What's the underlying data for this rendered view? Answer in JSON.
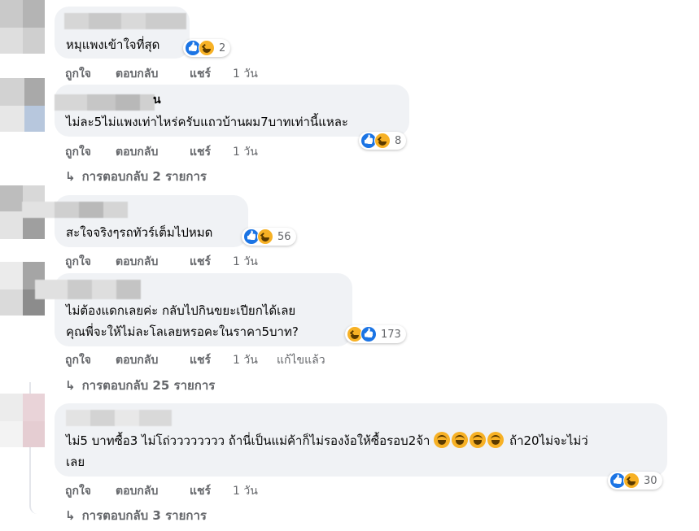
{
  "comments": [
    {
      "text": [
        "หมุแพงเข้าใจที่สุด"
      ],
      "reaction_count": "2",
      "actions": {
        "like": "ถูกใจ",
        "reply": "ตอบกลับ",
        "share": "แชร์",
        "time": "1 วัน"
      }
    },
    {
      "name_fragment": "น",
      "text": [
        "ไม่ละ5ไม่แพงเท่าไหร่ครับแถวบ้านผม7บาทเท่านี้แหละ"
      ],
      "reaction_count": "8",
      "actions": {
        "like": "ถูกใจ",
        "reply": "ตอบกลับ",
        "share": "แชร์",
        "time": "1 วัน"
      },
      "replies": "การตอบกลับ 2 รายการ"
    },
    {
      "text": [
        "สะใจจริงๆรถทัวร์เต็มไปหมด"
      ],
      "reaction_count": "56",
      "actions": {
        "like": "ถูกใจ",
        "reply": "ตอบกลับ",
        "share": "แชร์",
        "time": "1 วัน"
      }
    },
    {
      "text": [
        "ไม่ต้องแดกเลยค่ะ กลับไปกินขยะเปียกได้เลย",
        "คุณพี่จะให้ไม่ละโลเลยหรอคะในราคา5บาท?"
      ],
      "reaction_count": "173",
      "actions": {
        "like": "ถูกใจ",
        "reply": "ตอบกลับ",
        "share": "แชร์",
        "time": "1 วัน",
        "edited": "แก้ไขแล้ว"
      },
      "replies": "การตอบกลับ 25 รายการ"
    },
    {
      "text_pre": "ไม่5 บาทซื้อ3 ไม่โถ่วววววววว ถ้านี่เป็นแม่ค้าก็ไม่รองง้อให้ซื้อรอบ2จ้า ",
      "text_post": " ถ้า20ไม่จะไม่ว่",
      "text_line2": "เลย",
      "reaction_count": "30",
      "actions": {
        "like": "ถูกใจ",
        "reply": "ตอบกลับ",
        "share": "แชร์",
        "time": "1 วัน"
      },
      "replies": "การตอบกลับ 3 รายการ"
    }
  ],
  "icons": {
    "like": "like-reaction-icon",
    "haha": "haha-reaction-icon",
    "reply_arrow": "reply-arrow-icon",
    "laugh_emoji": "rofl-emoji-icon"
  },
  "arrow_glyph": "↳",
  "colors": {
    "bubble": "#f0f2f5",
    "meta": "#65676b",
    "like_blue": "#1b74e4",
    "haha_yellow": "#f7b125"
  }
}
